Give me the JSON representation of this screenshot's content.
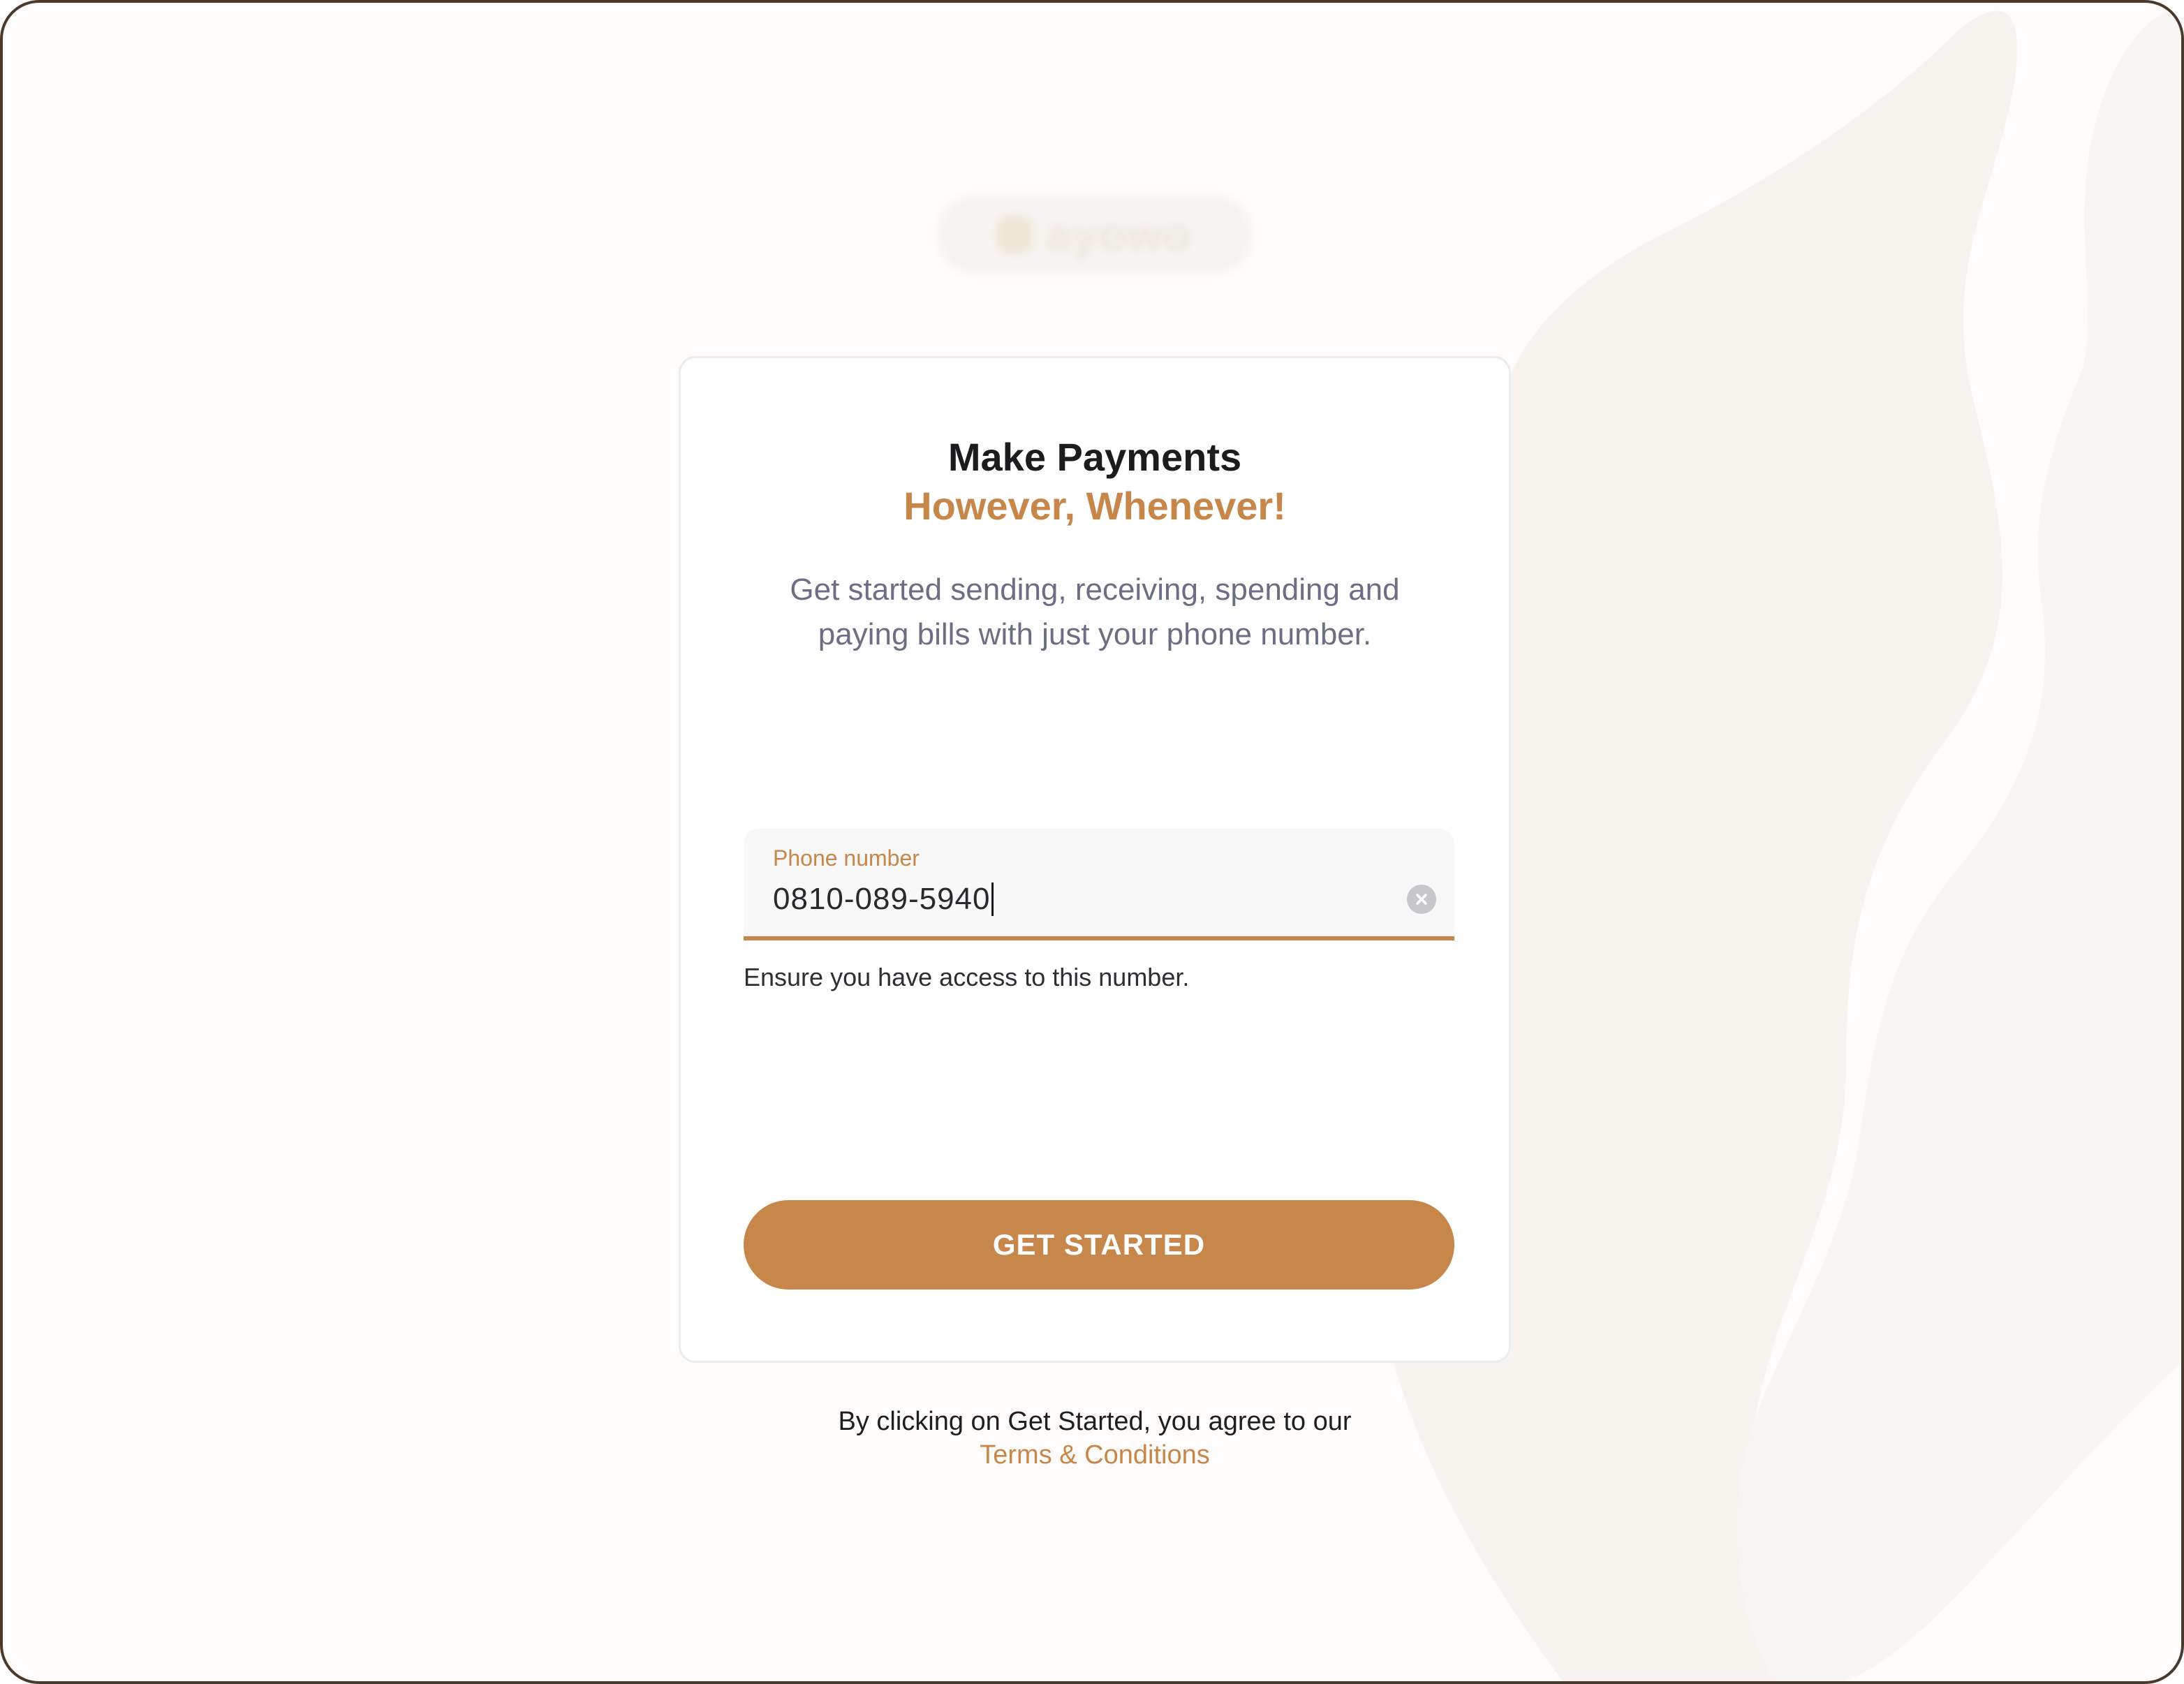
{
  "brand": {
    "logo_text": "ayowo",
    "accent_color": "#c8874a",
    "background_color": "#fdfcfb"
  },
  "card": {
    "title": "Make Payments",
    "subtitle": "However, Whenever!",
    "description": "Get started sending, receiving, spending and paying bills with just your phone number."
  },
  "phone_field": {
    "label": "Phone number",
    "value": "0810-089-5940",
    "clear_icon": "clear-circle-x",
    "helper_text": "Ensure you have access to this number."
  },
  "cta": {
    "label": "GET STARTED",
    "color": "#c8874a"
  },
  "footer": {
    "agreement_text": "By clicking on Get Started, you agree to our",
    "terms_link": "Terms & Conditions"
  }
}
